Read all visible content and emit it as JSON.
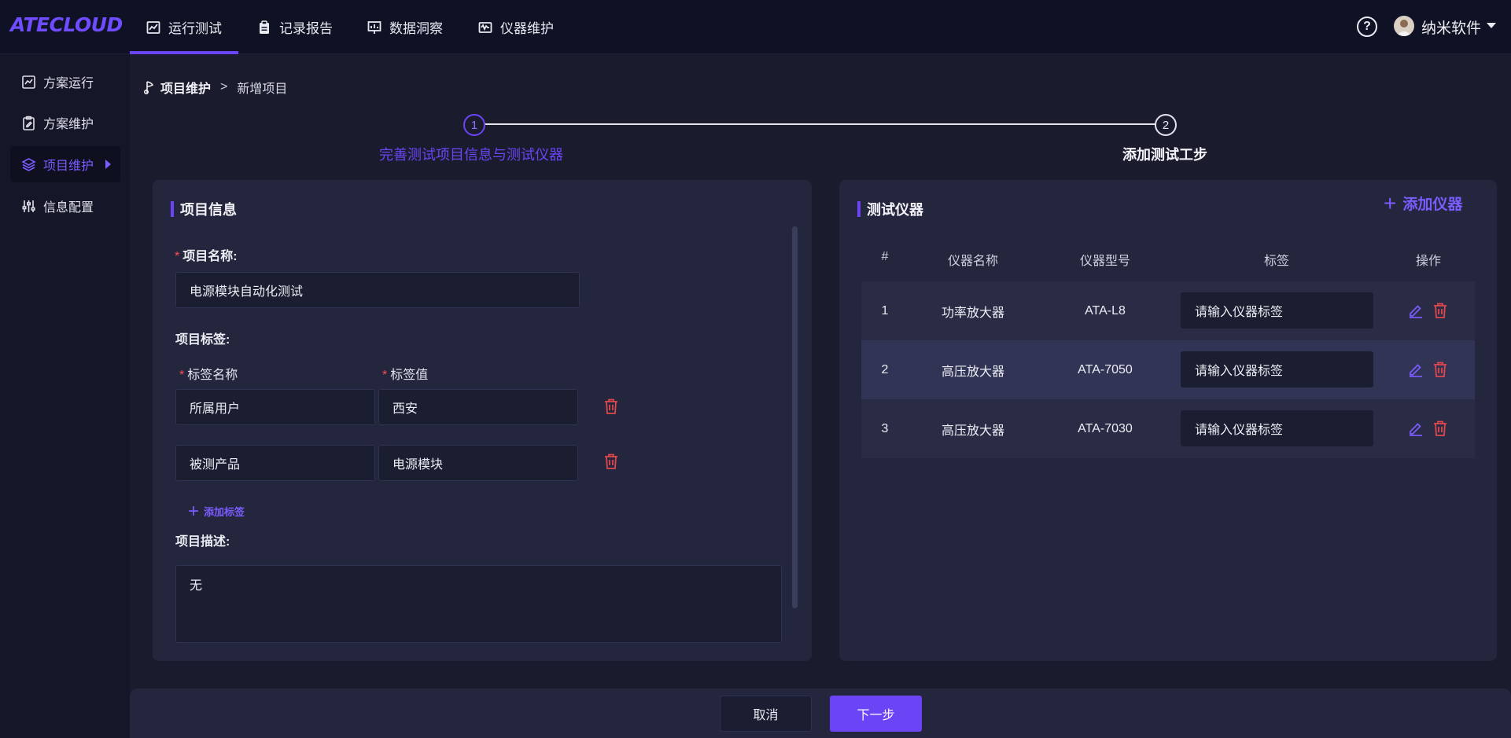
{
  "app": {
    "logo": "ATECLOUD"
  },
  "topnav": {
    "items": [
      {
        "label": "运行测试",
        "icon": "line-chart-icon",
        "active": true
      },
      {
        "label": "记录报告",
        "icon": "clipboard-icon",
        "active": false
      },
      {
        "label": "数据洞察",
        "icon": "presentation-chart-icon",
        "active": false
      },
      {
        "label": "仪器维护",
        "icon": "instrument-icon",
        "active": false
      }
    ],
    "help": "?",
    "user_name": "纳米软件"
  },
  "sidebar": {
    "items": [
      {
        "label": "方案运行",
        "icon": "chart-box-icon",
        "active": false
      },
      {
        "label": "方案维护",
        "icon": "clipboard-edit-icon",
        "active": false
      },
      {
        "label": "项目维护",
        "icon": "layers-icon",
        "active": true
      },
      {
        "label": "信息配置",
        "icon": "sliders-icon",
        "active": false
      }
    ]
  },
  "breadcrumb": {
    "first": "项目维护",
    "separator": ">",
    "current": "新增项目"
  },
  "steps": [
    {
      "number": "1",
      "label": "完善测试项目信息与测试仪器",
      "active": true
    },
    {
      "number": "2",
      "label": "添加测试工步",
      "active": false
    }
  ],
  "project_info": {
    "title": "项目信息",
    "name_label": "项目名称:",
    "name_value": "电源模块自动化测试",
    "tags_label": "项目标签:",
    "tag_name_header": "标签名称",
    "tag_value_header": "标签值",
    "tags": [
      {
        "name": "所属用户",
        "value": "西安"
      },
      {
        "name": "被测产品",
        "value": "电源模块"
      }
    ],
    "add_tag_label": "添加标签",
    "desc_label": "项目描述:",
    "desc_value": "无"
  },
  "instruments": {
    "title": "测试仪器",
    "add_label": "添加仪器",
    "columns": [
      "#",
      "仪器名称",
      "仪器型号",
      "标签",
      "操作"
    ],
    "rows": [
      {
        "index": "1",
        "name": "功率放大器",
        "model": "ATA-L8",
        "tag_placeholder": "请输入仪器标签"
      },
      {
        "index": "2",
        "name": "高压放大器",
        "model": "ATA-7050",
        "tag_placeholder": "请输入仪器标签"
      },
      {
        "index": "3",
        "name": "高压放大器",
        "model": "ATA-7030",
        "tag_placeholder": "请输入仪器标签"
      }
    ]
  },
  "footer": {
    "cancel_label": "取消",
    "next_label": "下一步"
  },
  "colors": {
    "accent": "#6b45f5",
    "danger": "#e0474c",
    "bg": "#1a1c2e",
    "panel": "#24263d"
  }
}
